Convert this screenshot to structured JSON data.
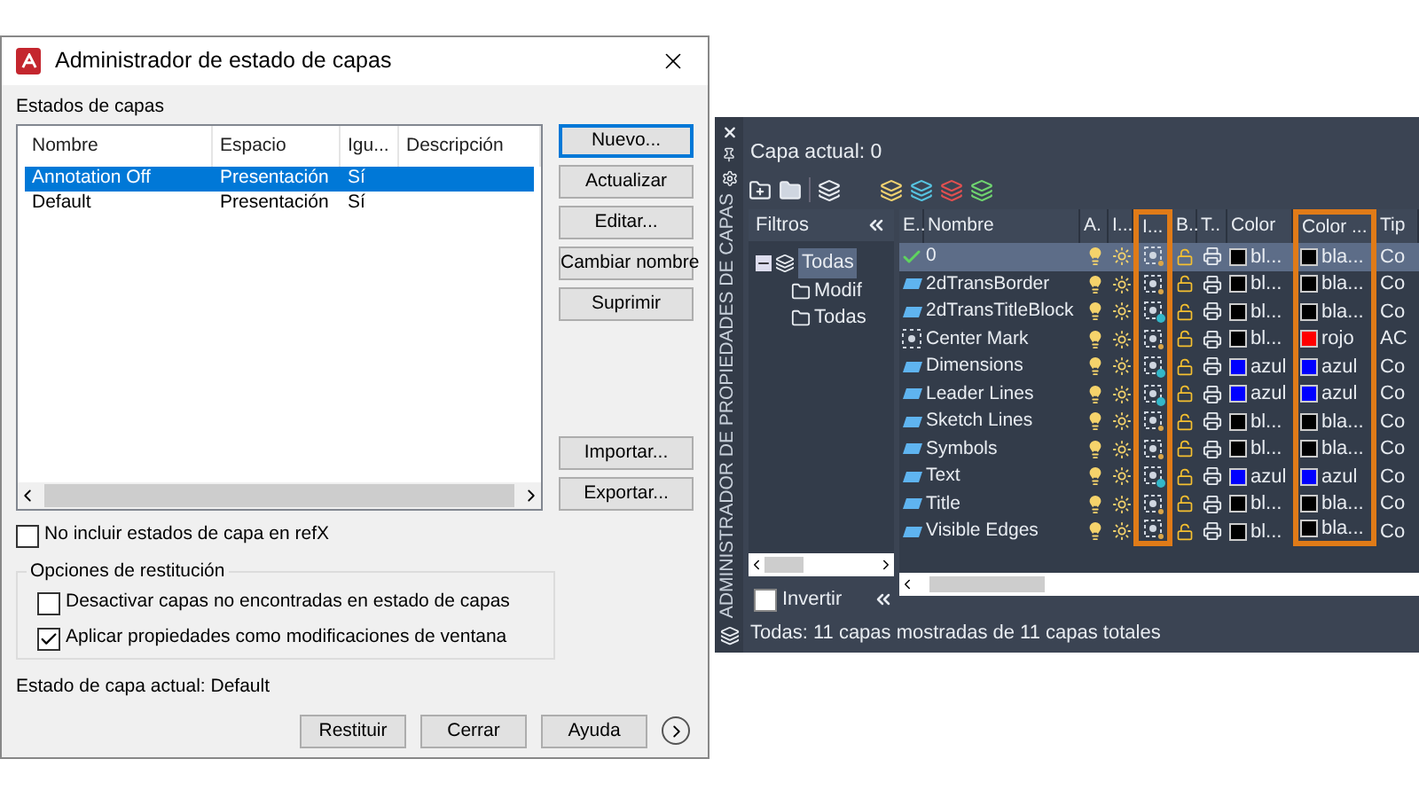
{
  "dialog": {
    "title": "Administrador de estado de capas",
    "section_label": "Estados de capas",
    "list": {
      "columns": [
        "Nombre",
        "Espacio",
        "Igu...",
        "Descripción"
      ],
      "rows": [
        {
          "name": "Annotation Off",
          "space": "Presentación",
          "equal": "Sí",
          "selected": true
        },
        {
          "name": "Default",
          "space": "Presentación",
          "equal": "Sí",
          "selected": false
        }
      ]
    },
    "side_buttons": [
      "Nuevo...",
      "Actualizar",
      "Editar...",
      "Cambiar nombre",
      "Suprimir"
    ],
    "io_buttons": [
      "Importar...",
      "Exportar..."
    ],
    "exclude_xref": {
      "label": "No incluir estados de capa en refX",
      "checked": false
    },
    "restore_options": {
      "legend": "Opciones de restitución",
      "options": [
        {
          "label": "Desactivar capas no encontradas en estado de capas",
          "checked": false
        },
        {
          "label": "Aplicar propiedades como modificaciones de ventana",
          "checked": true
        }
      ]
    },
    "status": "Estado de capa actual: Default",
    "bottom_buttons": [
      "Restituir",
      "Cerrar",
      "Ayuda"
    ]
  },
  "panel": {
    "side_title": "ADMINISTRADOR DE PROPIEDADES DE CAPAS",
    "current_layer": "Capa actual: 0",
    "filters": {
      "title": "Filtros",
      "tree": [
        {
          "label": "Todas",
          "selected": true,
          "children": [
            {
              "label": "Modif",
              "selected": false
            },
            {
              "label": "Todas",
              "selected": false
            }
          ]
        }
      ]
    },
    "invert": {
      "label": "Invertir",
      "checked": false
    },
    "columns": [
      {
        "label": "E..",
        "highlighted": false
      },
      {
        "label": "Nombre",
        "highlighted": false
      },
      {
        "label": "A.",
        "highlighted": false
      },
      {
        "label": "I...",
        "highlighted": false
      },
      {
        "label": "I...",
        "highlighted": true
      },
      {
        "label": "B..",
        "highlighted": false
      },
      {
        "label": "T..",
        "highlighted": false
      },
      {
        "label": "Color",
        "highlighted": false
      },
      {
        "label": "Color ...",
        "highlighted": true
      },
      {
        "label": "Tip",
        "highlighted": false
      }
    ],
    "rows": [
      {
        "kind": "current",
        "name": "0",
        "selected": true,
        "vp_freeze_new": false,
        "color_name": "bl...",
        "color": "#000000",
        "vp_color": {
          "name": "bla...",
          "color": "#000000"
        },
        "type": "Co"
      },
      {
        "kind": "layer",
        "name": "2dTransBorder",
        "selected": false,
        "vp_freeze_new": false,
        "color_name": "bl...",
        "color": "#000000",
        "vp_color": {
          "name": "bla...",
          "color": "#000000"
        },
        "type": "Co"
      },
      {
        "kind": "layer",
        "name": "2dTransTitleBlock",
        "selected": false,
        "vp_freeze_new": true,
        "color_name": "bl...",
        "color": "#000000",
        "vp_color": {
          "name": "bla...",
          "color": "#000000"
        },
        "type": "Co"
      },
      {
        "kind": "special",
        "name": "Center Mark",
        "selected": false,
        "vp_freeze_new": false,
        "color_name": "bl...",
        "color": "#000000",
        "vp_color": {
          "name": "rojo",
          "color": "#ff0000"
        },
        "type": "AC"
      },
      {
        "kind": "layer",
        "name": "Dimensions",
        "selected": false,
        "vp_freeze_new": true,
        "color_name": "azul",
        "color": "#0000ff",
        "vp_color": {
          "name": "azul",
          "color": "#0000ff"
        },
        "type": "Co"
      },
      {
        "kind": "layer",
        "name": "Leader Lines",
        "selected": false,
        "vp_freeze_new": true,
        "color_name": "azul",
        "color": "#0000ff",
        "vp_color": {
          "name": "azul",
          "color": "#0000ff"
        },
        "type": "Co"
      },
      {
        "kind": "layer",
        "name": "Sketch Lines",
        "selected": false,
        "vp_freeze_new": false,
        "color_name": "bl...",
        "color": "#000000",
        "vp_color": {
          "name": "bla...",
          "color": "#000000"
        },
        "type": "Co"
      },
      {
        "kind": "layer",
        "name": "Symbols",
        "selected": false,
        "vp_freeze_new": false,
        "color_name": "bl...",
        "color": "#000000",
        "vp_color": {
          "name": "bla...",
          "color": "#000000"
        },
        "type": "Co"
      },
      {
        "kind": "layer",
        "name": "Text",
        "selected": false,
        "vp_freeze_new": true,
        "color_name": "azul",
        "color": "#0000ff",
        "vp_color": {
          "name": "azul",
          "color": "#0000ff"
        },
        "type": "Co"
      },
      {
        "kind": "layer",
        "name": "Title",
        "selected": false,
        "vp_freeze_new": false,
        "color_name": "bl...",
        "color": "#000000",
        "vp_color": {
          "name": "bla...",
          "color": "#000000"
        },
        "type": "Co"
      },
      {
        "kind": "layer",
        "name": "Visible Edges",
        "selected": false,
        "vp_freeze_new": false,
        "color_name": "bl...",
        "color": "#000000",
        "vp_color": {
          "name": "bla...",
          "color": "#000000"
        },
        "type": "Co"
      }
    ],
    "status": "Todas: 11 capas mostradas de 11 capas totales"
  }
}
